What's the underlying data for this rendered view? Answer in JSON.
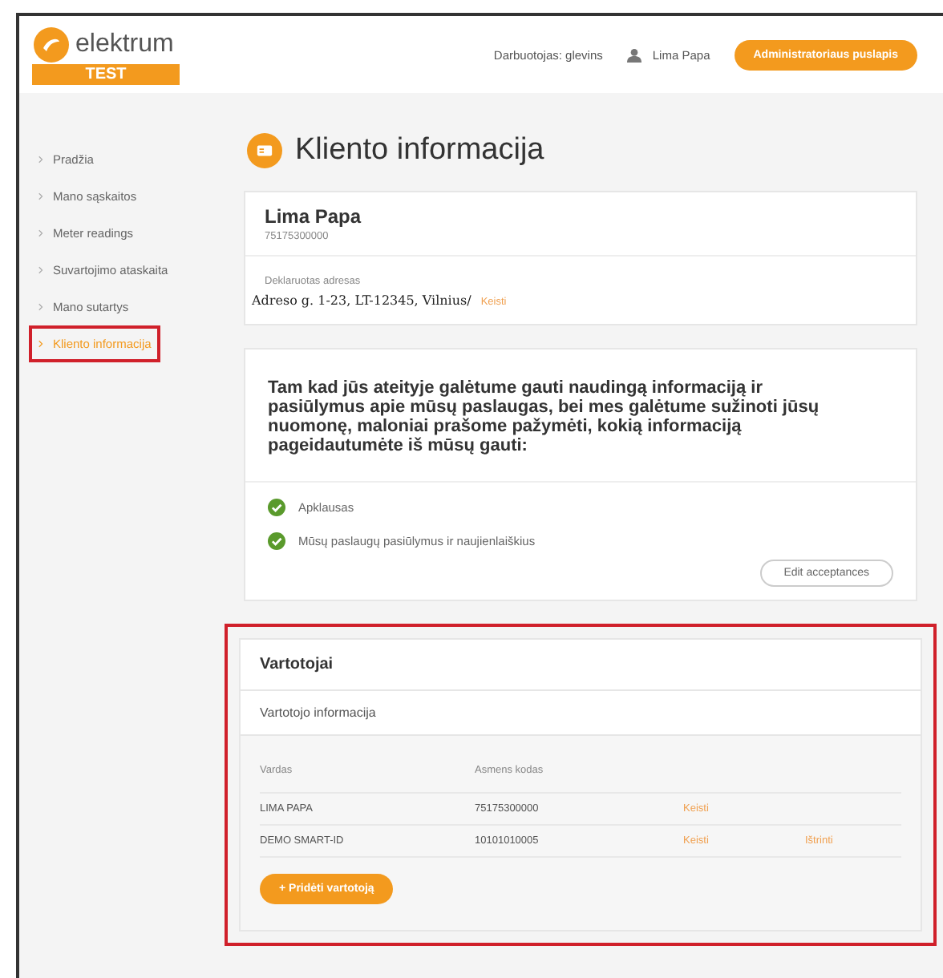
{
  "header": {
    "logo": "elektrum",
    "env_badge": "TEST",
    "employee": "Darbuotojas: glevins",
    "user": "Lima Papa",
    "admin_button": "Administratoriaus puslapis"
  },
  "sidebar": {
    "items": [
      {
        "label": "Pradžia",
        "selected": false,
        "highlighted": false
      },
      {
        "label": "Mano sąskaitos",
        "selected": false,
        "highlighted": false
      },
      {
        "label": "Meter readings",
        "selected": false,
        "highlighted": false
      },
      {
        "label": "Suvartojimo ataskaita",
        "selected": false,
        "highlighted": false
      },
      {
        "label": "Mano sutartys",
        "selected": false,
        "highlighted": false
      },
      {
        "label": "Kliento informacija",
        "selected": true,
        "highlighted": true
      }
    ]
  },
  "page_title": "Kliento informacija",
  "client": {
    "name": "Lima Papa",
    "code": "75175300000",
    "address_label": "Deklaruotas adresas",
    "address": "Adreso g. 1-23, LT-12345, Vilnius/",
    "edit_link": "Keisti"
  },
  "consents": {
    "intro": "Tam kad jūs ateityje galėtume gauti naudingą informaciją ir pasiūlymus apie mūsų paslaugas, bei mes galėtume sužinoti jūsų nuomonę, maloniai prašome pažymėti, kokią informaciją pageidautumėte iš mūsų gauti:",
    "items": [
      {
        "label": "Apklausas",
        "checked": true
      },
      {
        "label": "Mūsų paslaugų pasiūlymus ir naujienlaiškius",
        "checked": true
      }
    ],
    "button": "Edit acceptances"
  },
  "users": {
    "highlighted": true,
    "title": "Vartotojai",
    "subtitle": "Vartotojo informacija",
    "columns": [
      "Vardas",
      "Asmens kodas"
    ],
    "rows": [
      {
        "name": "LIMA PAPA",
        "code": "75175300000",
        "actions": [
          "Keisti"
        ]
      },
      {
        "name": "DEMO SMART-ID",
        "code": "10101010005",
        "actions": [
          "Keisti",
          "Ištrinti"
        ]
      }
    ],
    "add_button": "+ Pridėti vartotoją"
  }
}
